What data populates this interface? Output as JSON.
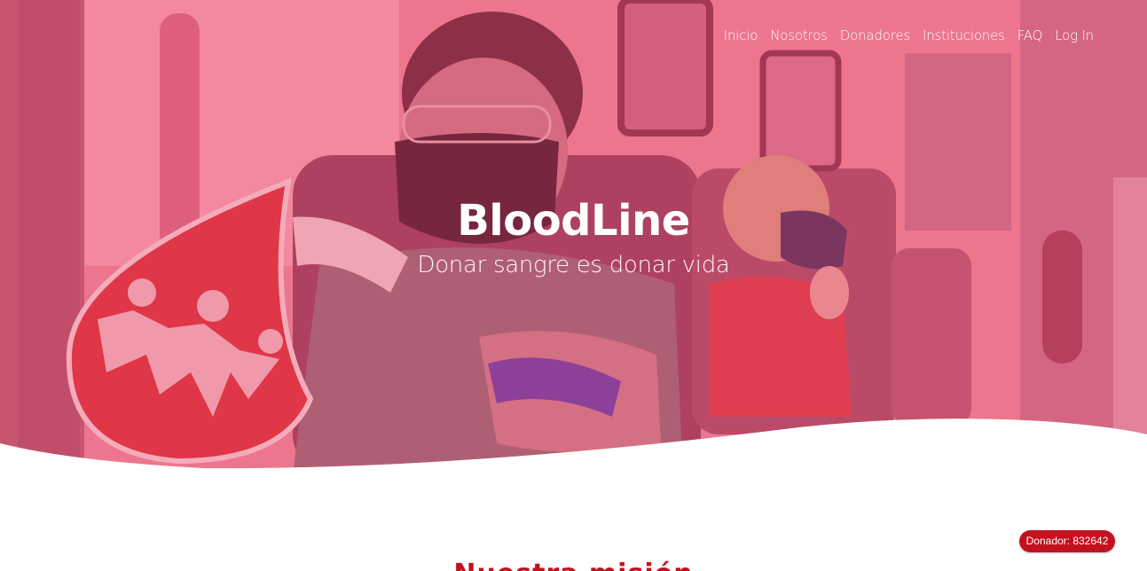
{
  "nav": {
    "items": [
      {
        "label": "Inicio"
      },
      {
        "label": "Nosotros"
      },
      {
        "label": "Donadores"
      },
      {
        "label": "Instituciones"
      },
      {
        "label": "FAQ"
      },
      {
        "label": "Log In"
      }
    ]
  },
  "hero": {
    "title": "BloodLine",
    "tagline": "Donar sangre es donar vida",
    "overlay_color": "#e8506e",
    "sign_color": "#d82b33"
  },
  "donor_badge": {
    "label": "Donador: 832642",
    "color": "#c3121f"
  },
  "section": {
    "heading": "Nuestra misión"
  }
}
